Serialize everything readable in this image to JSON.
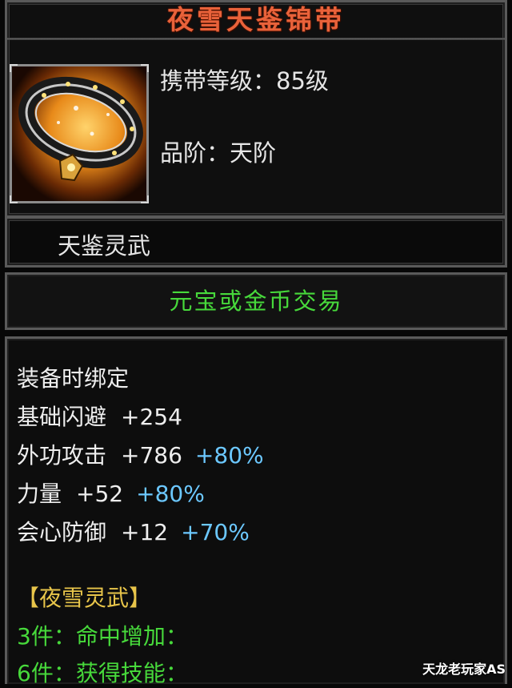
{
  "item": {
    "name": "夜雪天鉴锦带",
    "carry_level": "携带等级：85级",
    "grade": "品阶：天阶",
    "set_series": "天鉴灵武",
    "trade": "元宝或金币交易",
    "icon": "belt-icon"
  },
  "stats": {
    "bind": "装备时绑定",
    "lines": [
      {
        "name": "基础闪避",
        "value": "+254",
        "pct": ""
      },
      {
        "name": "外功攻击",
        "value": "+786",
        "pct": "+80%"
      },
      {
        "name": "力量",
        "value": "+52",
        "pct": "+80%"
      },
      {
        "name": "会心防御",
        "value": "+12",
        "pct": "+70%"
      }
    ]
  },
  "set": {
    "title": "【夜雪灵武】",
    "piece3": "3件：命中增加：",
    "piece6": "6件：获得技能："
  },
  "watermark": "天龙老玩家AS",
  "colors": {
    "title": "#e9623a",
    "trade": "#47d93b",
    "percent": "#6cc8ff",
    "set_title": "#e8c54a"
  }
}
